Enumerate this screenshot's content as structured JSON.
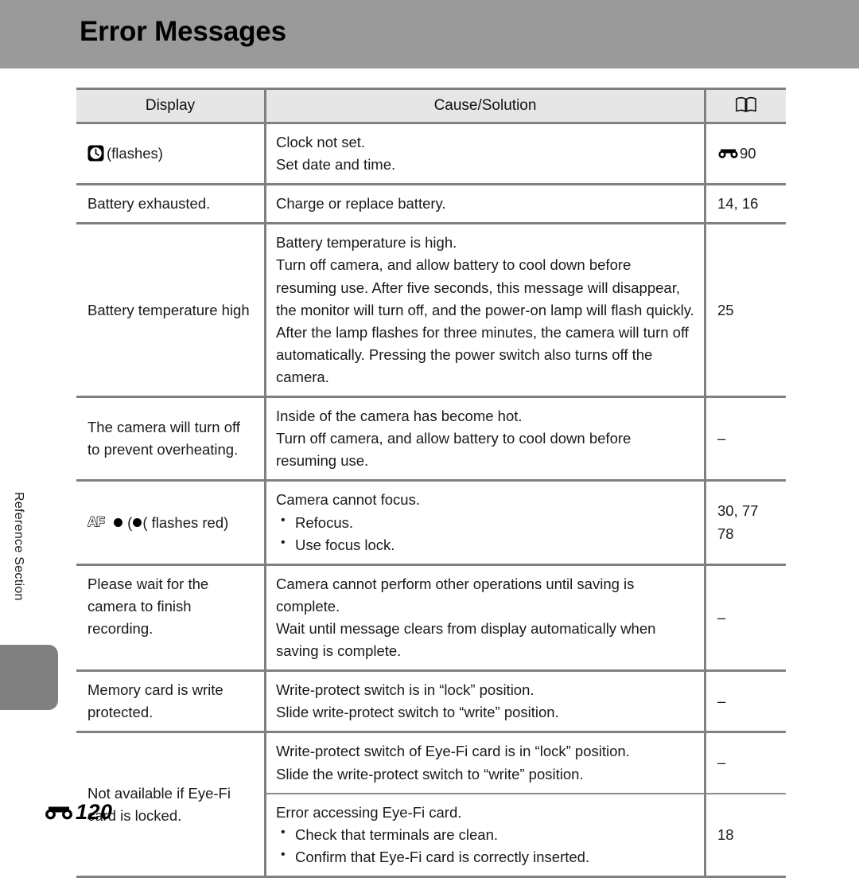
{
  "header": {
    "title": "Error Messages"
  },
  "side_tab": {
    "label": "Reference Section"
  },
  "table": {
    "columns": [
      {
        "label": "Display",
        "icon": ""
      },
      {
        "label": "Cause/Solution",
        "icon": ""
      },
      {
        "label": "",
        "icon": "book-icon"
      }
    ],
    "rows": [
      {
        "display_icon": "clock-icon",
        "display": "(flashes)",
        "cause_lines": [
          "Clock not set.",
          "Set date and time."
        ],
        "ref_icon": "e-reference-icon",
        "ref": "90"
      },
      {
        "display_icon": "",
        "display": "Battery exhausted.",
        "cause_lines": [
          "Charge or replace battery."
        ],
        "ref_icon": "",
        "ref": "14, 16"
      },
      {
        "display_icon": "",
        "display": "Battery temperature high",
        "cause_lines": [
          "Battery temperature is high.",
          "Turn off camera, and allow battery to cool down before resuming use. After five seconds, this message will disappear, the monitor will turn off, and the power-on lamp will flash quickly. After the lamp flashes for three minutes, the camera will turn off automatically. Pressing the power switch also turns off the camera."
        ],
        "ref_icon": "",
        "ref": "25"
      },
      {
        "display_icon": "",
        "display": "The camera will turn off to prevent overheating.",
        "cause_lines": [
          "Inside of the camera has become hot.",
          "Turn off camera, and allow battery to cool down before resuming use."
        ],
        "ref_icon": "",
        "ref": "–"
      },
      {
        "display_icon": "af-dot-icon",
        "display": "( flashes red)",
        "cause_lines": [
          "Camera cannot focus."
        ],
        "cause_bullets": [
          "Refocus.",
          "Use focus lock."
        ],
        "ref_icon": "",
        "ref": "30, 77",
        "ref2": "78"
      },
      {
        "display_icon": "",
        "display": "Please wait for the camera to finish recording.",
        "cause_lines": [
          "Camera cannot perform other operations until saving is complete.",
          "Wait until message clears from display automatically when saving is complete."
        ],
        "ref_icon": "",
        "ref": "–"
      },
      {
        "display_icon": "",
        "display": "Memory card is write protected.",
        "cause_lines": [
          "Write-protect switch is in “lock” position.",
          "Slide write-protect switch to “write” position."
        ],
        "ref_icon": "",
        "ref": "–"
      },
      {
        "display_icon": "",
        "display": "Not available if Eye-Fi card is locked.",
        "sub_rows": [
          {
            "cause_lines": [
              "Write-protect switch of Eye-Fi card is in “lock” position.",
              "Slide the write-protect switch to “write” position."
            ],
            "ref": "–"
          },
          {
            "cause_lines": [
              "Error accessing Eye-Fi card."
            ],
            "cause_bullets": [
              "Check that terminals are clean.",
              "Confirm that Eye-Fi card is correctly inserted."
            ],
            "ref": "18"
          }
        ]
      }
    ]
  },
  "footer": {
    "icon": "e-reference-icon",
    "page": "120"
  },
  "colors": {
    "header_band": "#9a9a9a",
    "side_tab": "#808080",
    "table_border": "#808080",
    "header_cell_bg": "#e6e6e6",
    "text": "#1a1a1a"
  }
}
